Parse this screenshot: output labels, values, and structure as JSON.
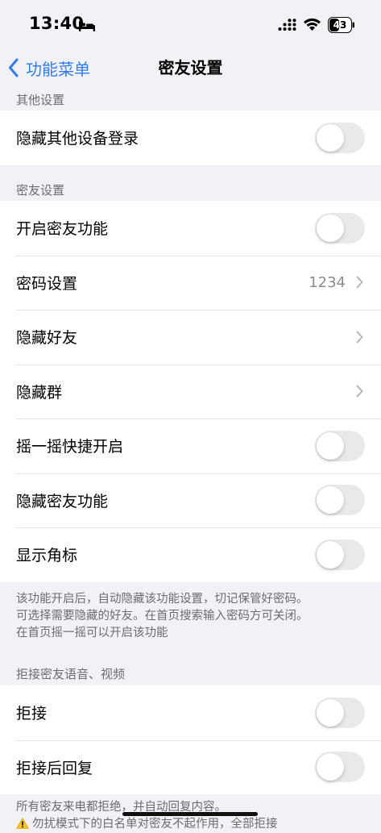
{
  "status_bar": {
    "time": "13:40",
    "battery_level": "43"
  },
  "nav": {
    "back_label": "功能菜单",
    "title": "密友设置"
  },
  "sections": [
    {
      "header": "其他设置",
      "rows": [
        {
          "label": "隐藏其他设备登录",
          "control": "toggle",
          "on": false
        }
      ]
    },
    {
      "header": "密友设置",
      "rows": [
        {
          "label": "开启密友功能",
          "control": "toggle",
          "on": false
        },
        {
          "label": "密码设置",
          "control": "value",
          "value": "1234"
        },
        {
          "label": "隐藏好友",
          "control": "chevron"
        },
        {
          "label": "隐藏群",
          "control": "chevron"
        },
        {
          "label": "摇一摇快捷开启",
          "control": "toggle",
          "on": false
        },
        {
          "label": "隐藏密友功能",
          "control": "toggle",
          "on": false
        },
        {
          "label": "显示角标",
          "control": "toggle",
          "on": false
        }
      ],
      "footer": [
        "该功能开启后，自动隐藏该功能设置，切记保管好密码。",
        "可选择需要隐藏的好友。在首页搜索输入密码方可关闭。",
        "在首页摇一摇可以开启该功能"
      ]
    },
    {
      "header": "拒接密友语音、视频",
      "rows": [
        {
          "label": "拒接",
          "control": "toggle",
          "on": false
        },
        {
          "label": "拒接后回复",
          "control": "toggle",
          "on": false
        }
      ],
      "footer": [
        "所有密友来电都拒绝，并自动回复内容。",
        "勿扰模式下的白名单对密友不起作用，全部拒接"
      ]
    }
  ],
  "colors": {
    "accent": "#2f7cf6",
    "background": "#f2f2f6",
    "toggle_off": "#e9e9eb",
    "secondary_text": "#6c6c70"
  },
  "icons": {
    "back": "chevron-left-icon",
    "disclosure": "chevron-right-icon",
    "warning": "warning-icon"
  }
}
